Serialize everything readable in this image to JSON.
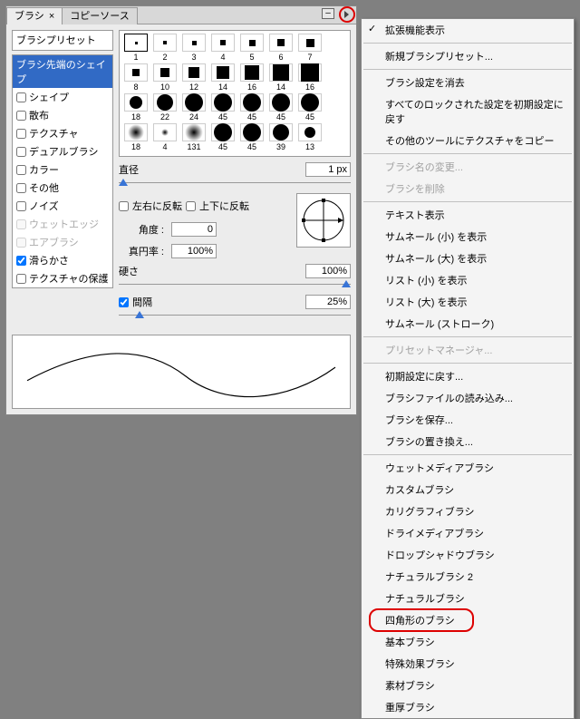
{
  "tabs": {
    "brush": "ブラシ",
    "close": "×",
    "clone": "コピーソース"
  },
  "preset_label": "ブラシプリセット",
  "opts": [
    {
      "label": "ブラシ先端のシェイプ",
      "sel": true
    },
    {
      "label": "シェイプ",
      "cb": true
    },
    {
      "label": "散布",
      "cb": true
    },
    {
      "label": "テクスチャ",
      "cb": true
    },
    {
      "label": "デュアルブラシ",
      "cb": true
    },
    {
      "label": "カラー",
      "cb": true
    },
    {
      "label": "その他",
      "cb": true
    },
    {
      "label": "ノイズ",
      "cb": true
    },
    {
      "label": "ウェットエッジ",
      "cb": true,
      "dis": true
    },
    {
      "label": "エアブラシ",
      "cb": true,
      "dis": true
    },
    {
      "label": "滑らかさ",
      "cb": true,
      "chk": true
    },
    {
      "label": "テクスチャの保護",
      "cb": true
    }
  ],
  "thumbs": [
    [
      [
        "sq",
        3,
        "1",
        true
      ],
      [
        "sq",
        4,
        "2"
      ],
      [
        "sq",
        5,
        "3"
      ],
      [
        "sq",
        6,
        "4"
      ],
      [
        "sq",
        7,
        "5"
      ],
      [
        "sq",
        8,
        "6"
      ],
      [
        "sq",
        9,
        "7"
      ]
    ],
    [
      [
        "sq",
        8,
        "8"
      ],
      [
        "sq",
        10,
        "10"
      ],
      [
        "sq",
        12,
        "12"
      ],
      [
        "sq",
        14,
        "14"
      ],
      [
        "sq",
        16,
        "16"
      ],
      [
        "sq",
        18,
        "14"
      ],
      [
        "sq",
        20,
        "16"
      ]
    ],
    [
      [
        "ci",
        14,
        "18"
      ],
      [
        "ci",
        18,
        "22"
      ],
      [
        "ci",
        20,
        "24"
      ],
      [
        "ci",
        20,
        "45"
      ],
      [
        "ci",
        20,
        "45"
      ],
      [
        "ci",
        20,
        "45"
      ],
      [
        "ci",
        20,
        "45"
      ]
    ],
    [
      [
        "sf",
        18,
        "18"
      ],
      [
        "sf",
        8,
        "4"
      ],
      [
        "sf",
        20,
        "131"
      ],
      [
        "ci",
        20,
        "45"
      ],
      [
        "ci",
        20,
        "45"
      ],
      [
        "ci",
        18,
        "39"
      ],
      [
        "ci",
        12,
        "13"
      ]
    ]
  ],
  "ctrl": {
    "diameter_label": "直径",
    "diameter_val": "1 px",
    "flipx": "左右に反転",
    "flipy": "上下に反転",
    "angle_label": "角度 :",
    "angle_val": "0",
    "roundness_label": "真円率 :",
    "roundness_val": "100%",
    "hardness_label": "硬さ",
    "hardness_val": "100%",
    "spacing_label": "間隔",
    "spacing_val": "25%"
  },
  "menu": [
    {
      "t": "拡張機能表示",
      "chk": true
    },
    {
      "sep": true
    },
    {
      "t": "新規ブラシプリセット..."
    },
    {
      "sep": true
    },
    {
      "t": "ブラシ設定を消去"
    },
    {
      "t": "すべてのロックされた設定を初期設定に戻す"
    },
    {
      "t": "その他のツールにテクスチャをコピー"
    },
    {
      "sep": true
    },
    {
      "t": "ブラシ名の変更...",
      "dis": true
    },
    {
      "t": "ブラシを削除",
      "dis": true
    },
    {
      "sep": true
    },
    {
      "t": "テキスト表示"
    },
    {
      "t": "サムネール (小) を表示"
    },
    {
      "t": "サムネール (大) を表示"
    },
    {
      "t": "リスト (小) を表示"
    },
    {
      "t": "リスト (大) を表示"
    },
    {
      "t": "サムネール (ストローク)"
    },
    {
      "sep": true
    },
    {
      "t": "プリセットマネージャ...",
      "dis": true
    },
    {
      "sep": true
    },
    {
      "t": "初期設定に戻す..."
    },
    {
      "t": "ブラシファイルの読み込み..."
    },
    {
      "t": "ブラシを保存..."
    },
    {
      "t": "ブラシの置き換え..."
    },
    {
      "sep": true
    },
    {
      "t": "ウェットメディアブラシ"
    },
    {
      "t": "カスタムブラシ"
    },
    {
      "t": "カリグラフィブラシ"
    },
    {
      "t": "ドライメディアブラシ"
    },
    {
      "t": "ドロップシャドウブラシ"
    },
    {
      "t": "ナチュラルブラシ 2"
    },
    {
      "t": "ナチュラルブラシ"
    },
    {
      "t": "四角形のブラシ",
      "hi": true
    },
    {
      "t": "基本ブラシ"
    },
    {
      "t": "特殊効果ブラシ"
    },
    {
      "t": "素材ブラシ"
    },
    {
      "t": "重厚ブラシ"
    }
  ]
}
